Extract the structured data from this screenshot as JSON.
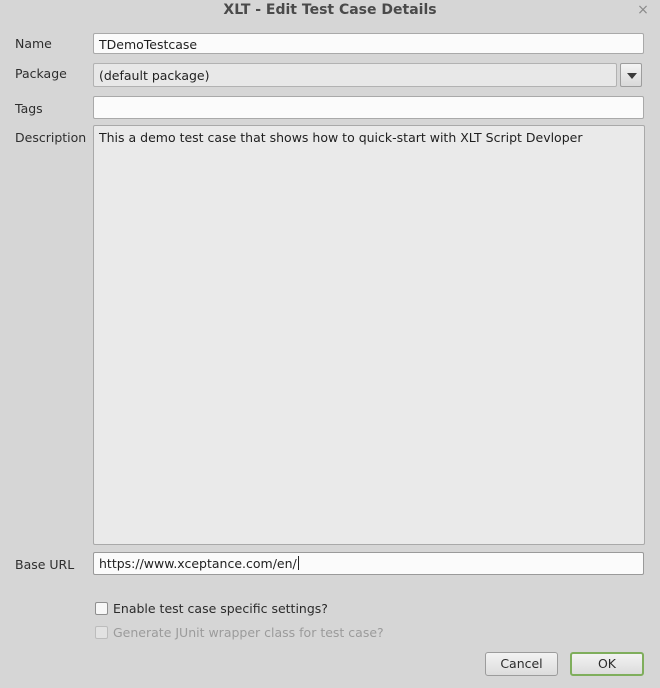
{
  "window": {
    "title": "XLT - Edit Test Case Details",
    "close_glyph": "×"
  },
  "form": {
    "name": {
      "label": "Name",
      "value": "TDemoTestcase"
    },
    "package": {
      "label": "Package",
      "value": "(default package)"
    },
    "tags": {
      "label": "Tags",
      "value": ""
    },
    "description": {
      "label": "Description",
      "value": "This a demo test case that shows how to quick-start with XLT Script Devloper"
    },
    "base_url": {
      "label": "Base URL",
      "value": "https://www.xceptance.com/en/"
    }
  },
  "options": {
    "enable_specific_settings": {
      "label": "Enable test case specific settings?",
      "checked": false,
      "enabled": true
    },
    "generate_junit_wrapper": {
      "label": "Generate JUnit wrapper class for test case?",
      "checked": false,
      "enabled": false
    }
  },
  "buttons": {
    "cancel": "Cancel",
    "ok": "OK"
  },
  "colors": {
    "ok_border": "#7fae5c",
    "background": "#d6d6d6"
  }
}
